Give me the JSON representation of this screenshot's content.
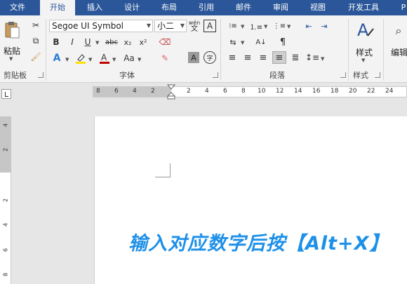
{
  "tabs": [
    {
      "label": "文件",
      "active": false
    },
    {
      "label": "开始",
      "active": true
    },
    {
      "label": "插入",
      "active": false
    },
    {
      "label": "设计",
      "active": false
    },
    {
      "label": "布局",
      "active": false
    },
    {
      "label": "引用",
      "active": false
    },
    {
      "label": "邮件",
      "active": false
    },
    {
      "label": "审阅",
      "active": false
    },
    {
      "label": "视图",
      "active": false
    },
    {
      "label": "开发工具",
      "active": false
    },
    {
      "label": "P",
      "active": false
    }
  ],
  "clipboard": {
    "paste_label": "粘贴",
    "group_label": "剪贴板"
  },
  "font": {
    "name": "Segoe UI Symbol",
    "size": "小二",
    "group_label": "字体",
    "bold": "B",
    "italic": "I",
    "underline": "U",
    "strike": "abc",
    "subscript": "x₂",
    "superscript": "x²",
    "grow_shrink": "Aa",
    "phonetic": "wén",
    "char_border": "A",
    "char_shading": "A",
    "enclose": "字"
  },
  "paragraph": {
    "group_label": "段落"
  },
  "styles": {
    "label": "样式",
    "group_label": "样式"
  },
  "editing": {
    "label": "编辑"
  },
  "ruler": {
    "h_labels": [
      "8",
      "6",
      "4",
      "2",
      "2",
      "4",
      "6",
      "8",
      "10",
      "12",
      "14",
      "16",
      "18",
      "20",
      "22",
      "24"
    ],
    "v_labels": [
      "4",
      "2",
      "2",
      "4",
      "6",
      "8"
    ]
  },
  "document": {
    "caption": "输入对应数字后按【Alt+X】"
  },
  "colors": {
    "accent": "#2b579a",
    "caption": "#1e90e8"
  }
}
